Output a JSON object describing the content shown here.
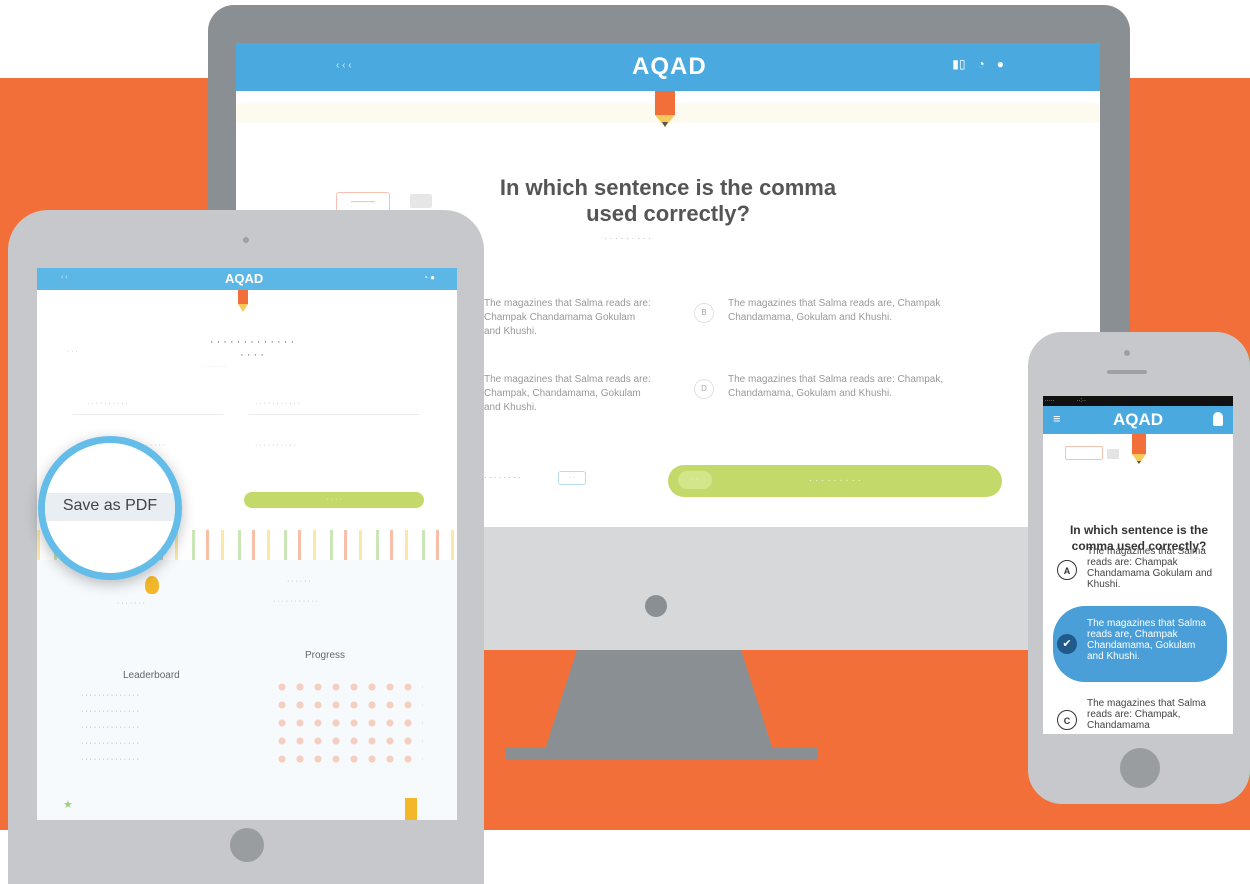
{
  "desktop": {
    "logo": "AQAD",
    "question": "In which sentence is the comma used correctly?",
    "options": [
      {
        "letter": "",
        "text": "The magazines that Salma reads are: Champak Chandamama Gokulam and Khushi."
      },
      {
        "letter": "B",
        "text": "The magazines that Salma reads are, Champak Chandamama, Gokulam and Khushi."
      },
      {
        "letter": "",
        "text": "The magazines that Salma reads are: Champak, Chandamama, Gokulam and Khushi."
      },
      {
        "letter": "D",
        "text": "The magazines that Salma reads are: Champak, Chandamama, Gokulam and Khushi."
      }
    ]
  },
  "tablet": {
    "logo": "AQAD",
    "zoom_label": "Save as PDF",
    "ranking_heading": "Leaderboard",
    "history_heading": "Progress"
  },
  "phone": {
    "logo": "AQAD",
    "question": "In which sentence is the comma used correctly?",
    "options": [
      {
        "letter": "A",
        "text": "The magazines that Salma reads are: Champak Chandamama Gokulam and Khushi.",
        "selected": false
      },
      {
        "letter": "",
        "text": "The magazines that Salma reads are, Champak Chandamama, Gokulam and Khushi.",
        "selected": true
      },
      {
        "letter": "C",
        "text": "The magazines that Salma reads are: Champak, Chandamama",
        "selected": false
      }
    ]
  },
  "colors": {
    "background_band": "#f26f3a",
    "header_blue": "#4aaadf",
    "submit_green": "#c3d96a",
    "selected_blue": "#4a9fd8",
    "device_gray": "#8a8f93"
  },
  "icons": [
    "pencil-icon",
    "user-icon",
    "checkmark-icon",
    "menu-icon",
    "medal-icon",
    "trophy-icon"
  ]
}
